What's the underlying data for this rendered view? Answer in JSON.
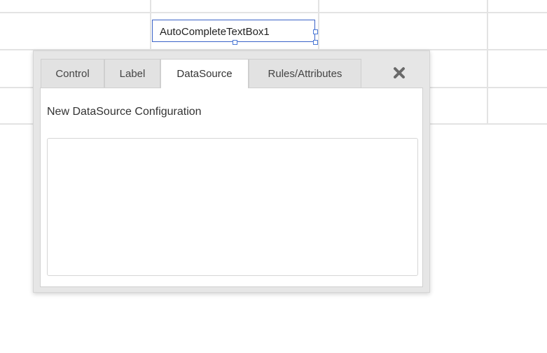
{
  "canvas": {
    "control_label": "AutoCompleteTextBox1"
  },
  "panel": {
    "tabs": [
      {
        "label": "Control"
      },
      {
        "label": "Label"
      },
      {
        "label": "DataSource"
      },
      {
        "label": "Rules/Attributes"
      }
    ],
    "active_tab": "DataSource",
    "close_icon": "close-icon",
    "content": {
      "title": "New DataSource Configuration",
      "config_value": ""
    }
  },
  "colors": {
    "selection_border": "#3a63c8",
    "panel_background": "#e6e6e6",
    "grid_line": "#e3e3e3"
  }
}
